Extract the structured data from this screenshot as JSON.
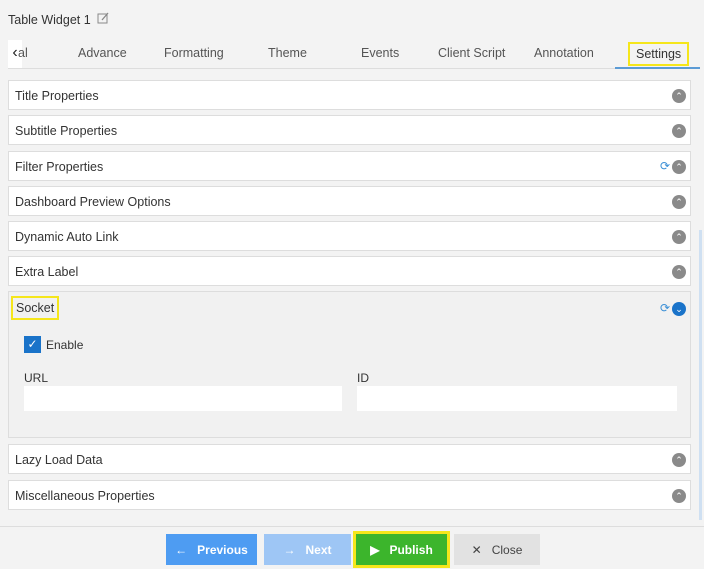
{
  "header": {
    "title": "Table Widget 1",
    "edit_icon": "pencil-icon"
  },
  "tabs": [
    {
      "label": "al"
    },
    {
      "label": "Advance"
    },
    {
      "label": "Formatting"
    },
    {
      "label": "Theme"
    },
    {
      "label": "Events"
    },
    {
      "label": "Client Script"
    },
    {
      "label": "Annotation"
    },
    {
      "label": "Settings",
      "active": true
    }
  ],
  "panels": [
    {
      "label": "Title Properties"
    },
    {
      "label": "Subtitle Properties"
    },
    {
      "label": "Filter Properties",
      "sync": true
    },
    {
      "label": "Dashboard Preview Options"
    },
    {
      "label": "Dynamic Auto Link"
    },
    {
      "label": "Extra Label"
    },
    {
      "label": "Socket",
      "expanded": true,
      "sync": true
    },
    {
      "label": "Lazy Load Data"
    },
    {
      "label": "Miscellaneous Properties"
    }
  ],
  "socket": {
    "enable_label": "Enable",
    "enabled": true,
    "url_label": "URL",
    "url_value": "",
    "id_label": "ID",
    "id_value": ""
  },
  "footer": {
    "previous": "Previous",
    "next": "Next",
    "publish": "Publish",
    "close": "Close"
  },
  "colors": {
    "accent": "#1a73c9",
    "publish": "#3cb52c",
    "previous": "#4e9cf2",
    "next": "#9ec6f5",
    "highlight": "#f5e61b"
  }
}
